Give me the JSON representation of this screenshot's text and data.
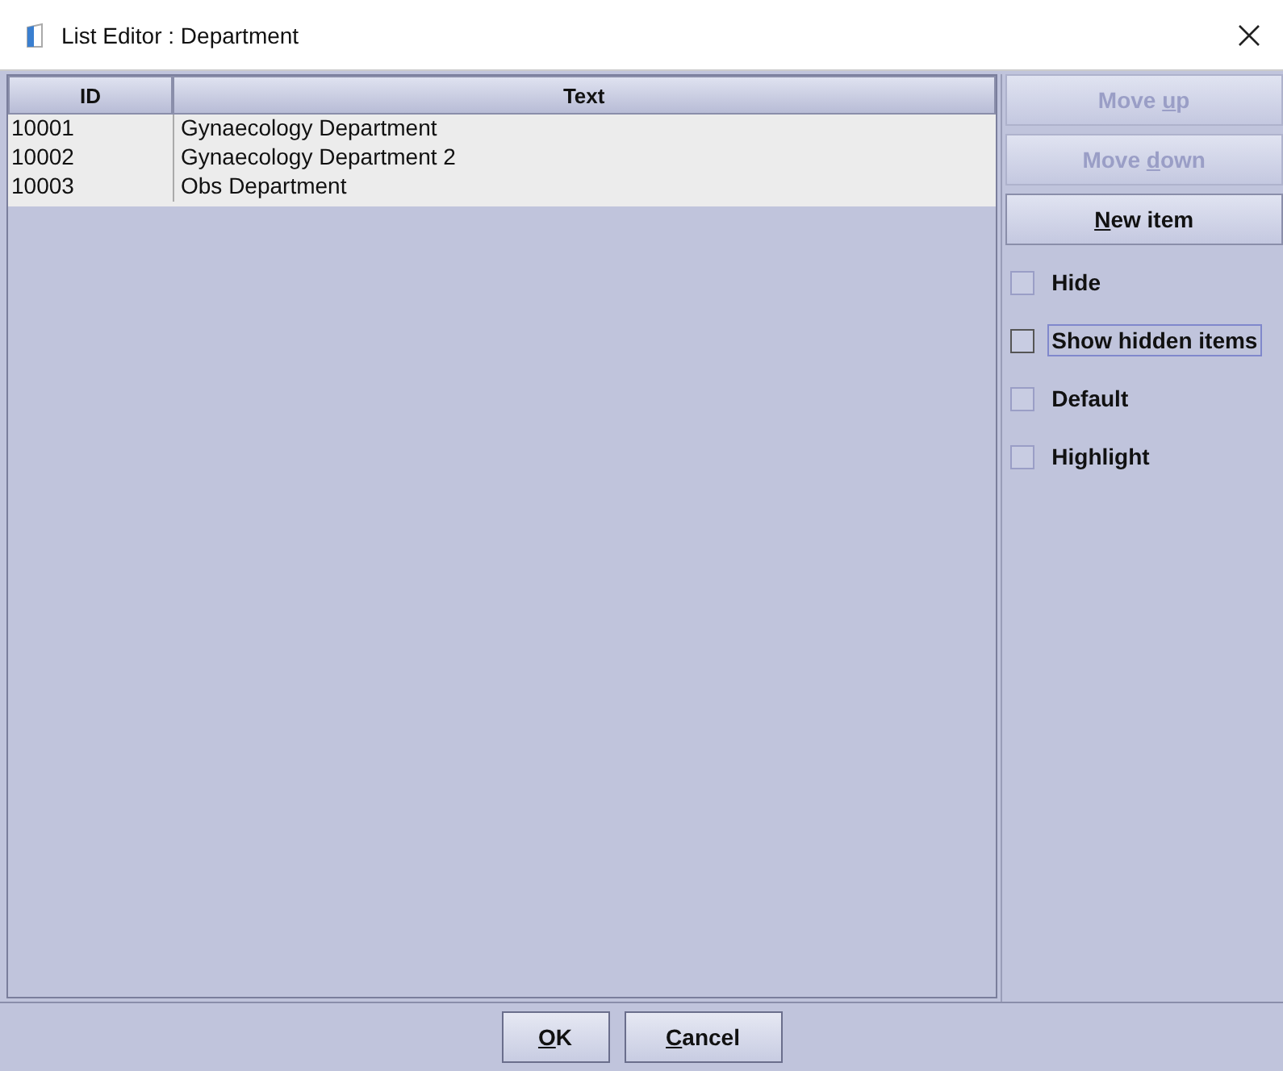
{
  "window": {
    "title": "List Editor : Department"
  },
  "table": {
    "columns": [
      "ID",
      "Text"
    ],
    "rows": [
      {
        "id": "10001",
        "text": "Gynaecology Department"
      },
      {
        "id": "10002",
        "text": "Gynaecology Department 2"
      },
      {
        "id": "10003",
        "text": "Obs Department"
      }
    ]
  },
  "side_buttons": [
    {
      "pre": "Move ",
      "key": "u",
      "post": "p",
      "disabled": true
    },
    {
      "pre": "Move ",
      "key": "d",
      "post": "own",
      "disabled": true
    },
    {
      "key": "N",
      "post": "ew item",
      "disabled": false
    }
  ],
  "checkboxes": [
    {
      "label": "Hide",
      "checked": false,
      "focused": false
    },
    {
      "label": "Show hidden items",
      "checked": false,
      "focused": true
    },
    {
      "label": "Default",
      "checked": false,
      "focused": false
    },
    {
      "label": "Highlight",
      "checked": false,
      "focused": false
    }
  ],
  "buttons": [
    {
      "key": "O",
      "post": "K"
    },
    {
      "key": "C",
      "post": "ancel"
    }
  ]
}
